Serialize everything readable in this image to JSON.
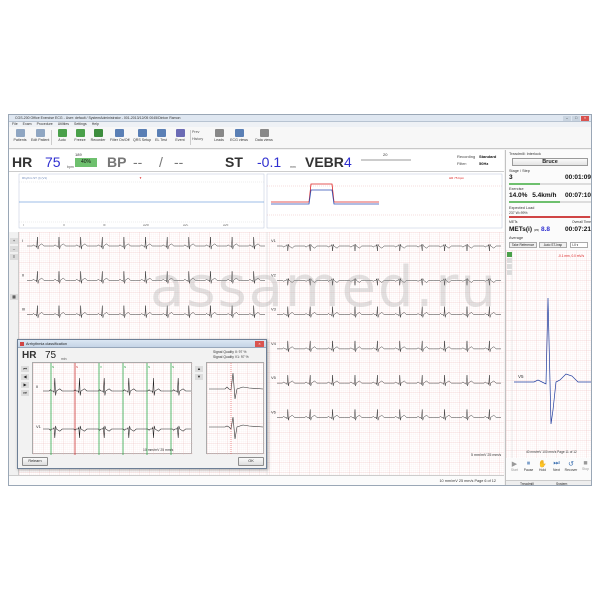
{
  "window": {
    "title": "CGS-200 Office Exercise ECG - User: default / SystemAdministrator - 001-2013/12/05 0045/Dinton Ramon"
  },
  "menu": [
    "File",
    "Exam",
    "Procedure",
    "Utilities",
    "Settings",
    "Help"
  ],
  "toolbar": {
    "buttons": [
      {
        "label": "Patients",
        "icon": "patients-icon",
        "color": "#8fa6c2"
      },
      {
        "label": "Edit Patient",
        "icon": "edit-patient-icon",
        "color": "#8fa6c2"
      },
      {
        "label": "Auto",
        "icon": "auto-icon",
        "color": "#4aa04a"
      },
      {
        "label": "Freeze",
        "icon": "freeze-icon",
        "color": "#4aa04a"
      },
      {
        "label": "Recorder",
        "icon": "recorder-icon",
        "color": "#3d8d3d"
      },
      {
        "label": "Filter On/Off",
        "icon": "filter-icon",
        "color": "#5a7fb5"
      },
      {
        "label": "QRS Setup",
        "icon": "qrs-icon",
        "color": "#5a7fb5"
      },
      {
        "label": "EL Test",
        "icon": "el-test-icon",
        "color": "#5a7fb5"
      },
      {
        "label": "Event",
        "icon": "event-icon",
        "color": "#6b6bb5"
      },
      {
        "label": "Leads",
        "icon": "leads-icon",
        "color": "#888888"
      },
      {
        "label": "ECG views",
        "icon": "ecg-views-icon",
        "color": "#5a7fb5"
      },
      {
        "label": "Data views",
        "icon": "data-views-icon",
        "color": "#888888"
      }
    ],
    "prev_label": "Prev",
    "history_label": "History"
  },
  "status": {
    "hr_label": "HR",
    "hr_value": "75",
    "hr_max": "189",
    "hr_percent": "40%",
    "hr_unit": "bpm",
    "bp_label": "BP",
    "bp_sys": "--",
    "bp_slash": "/",
    "bp_dia": "--",
    "st_label": "ST",
    "st_value": "-0.1",
    "st_unit": "mm",
    "vebr_label": "VEBR",
    "vebr_value": "4",
    "vebr_max": "20",
    "recording_label": "Recording",
    "recording_value": "Standard",
    "filter_label": "Filter:",
    "filter_value": "50Hz"
  },
  "right_panel": {
    "device_label": "Treadmill: Interlock",
    "protocol_button": "Bruce",
    "stage_label": "Stage / Step",
    "stage_value": "3",
    "stage_time": "00:01:09",
    "exercise_label": "Exercise",
    "speed_value": "14.0%",
    "grade_value": "5.4km/h",
    "exercise_time": "00:07:10",
    "expected_load_label": "Expected Load",
    "expected_load_value": "237 W=99%",
    "expected_load_fraction": 0.99,
    "mets_label": "METs(i)",
    "mets_unit": "(35)",
    "mets_value": "8.8",
    "overall_label": "Overall Time",
    "overall_time": "00:07:21",
    "average_label": "Average",
    "take_reference": "Take Reference",
    "auto_st": "Auto ST-Insp",
    "lead_select": "I-II",
    "st_readout": "-0.1 mm, 0.0 mV/s",
    "avg_lead": "V5",
    "scale_footer": "40 mm/mV  100 mm/s  Page 11 of 12",
    "controls": [
      {
        "label": "Start",
        "icon": "start-icon"
      },
      {
        "label": "Pause",
        "icon": "pause-icon"
      },
      {
        "label": "Hold",
        "icon": "hold-icon"
      },
      {
        "label": "Next",
        "icon": "next-icon"
      },
      {
        "label": "Recover",
        "icon": "recover-icon"
      },
      {
        "label": "Stop",
        "icon": "stop-icon"
      }
    ],
    "bottom_tabs": [
      "Treadmill",
      "System"
    ]
  },
  "trend": {
    "left_title": "Rhythm ST (I) (V1)",
    "right_title": "HR 75 bpm",
    "lead_labels": [
      "I",
      "II",
      "III",
      "aVR",
      "aVL",
      "aVF",
      "V1",
      "V2",
      "V3",
      "V4",
      "V5",
      "V6"
    ]
  },
  "ecg": {
    "left_leads": [
      "I",
      "II",
      "III",
      "aVR",
      "aVL",
      "aVF"
    ],
    "right_leads": [
      "V1",
      "V2",
      "V3",
      "V4",
      "V5",
      "V6"
    ],
    "scale_label": "5 mm/mV  25 mm/s",
    "footer": "10 mm/mV  25 mm/s  Page 6 of 12"
  },
  "dialog": {
    "title": "Arrhythmia classification",
    "hr_label": "HR",
    "hr_value": "75",
    "hr_unit": "min",
    "signal_quality_1": "Signal Quality II: 97 %",
    "signal_quality_2": "Signal Quality V1: 97 %",
    "lead1": "II",
    "lead2": "V1",
    "mark_labels": [
      "N",
      "S",
      "V",
      "N",
      "N",
      "N"
    ],
    "scale_label": "10 mm/mV  25 mm/s",
    "reset_button": "Relearn",
    "ok_button": "OK"
  },
  "watermark": "assamed.ru"
}
